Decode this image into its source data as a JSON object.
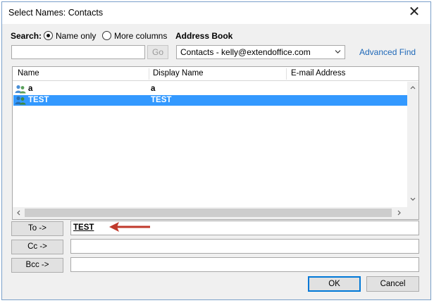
{
  "window": {
    "title": "Select Names: Contacts",
    "close_glyph": "✕"
  },
  "search": {
    "label": "Search:",
    "option_name_only": "Name only",
    "option_more_columns": "More columns",
    "selected_option": "Name only",
    "input_value": "",
    "go_label": "Go"
  },
  "address_book": {
    "label": "Address Book",
    "selected": "Contacts - kelly@extendoffice.com",
    "advanced_find": "Advanced Find"
  },
  "list": {
    "columns": [
      "Name",
      "Display Name",
      "E-mail Address"
    ],
    "rows": [
      {
        "name": "a",
        "display": "a",
        "email": "",
        "icon": "contact-group-icon",
        "selected": false
      },
      {
        "name": "TEST",
        "display": "TEST",
        "email": "",
        "icon": "contact-group-icon",
        "selected": true
      }
    ]
  },
  "recipients": {
    "to_label": "To ->",
    "to_value": "TEST",
    "cc_label": "Cc ->",
    "cc_value": "",
    "bcc_label": "Bcc ->",
    "bcc_value": ""
  },
  "footer": {
    "ok_label": "OK",
    "cancel_label": "Cancel"
  },
  "colors": {
    "selection": "#3399ff",
    "link": "#1e68b8",
    "arrow": "#c0392b"
  }
}
